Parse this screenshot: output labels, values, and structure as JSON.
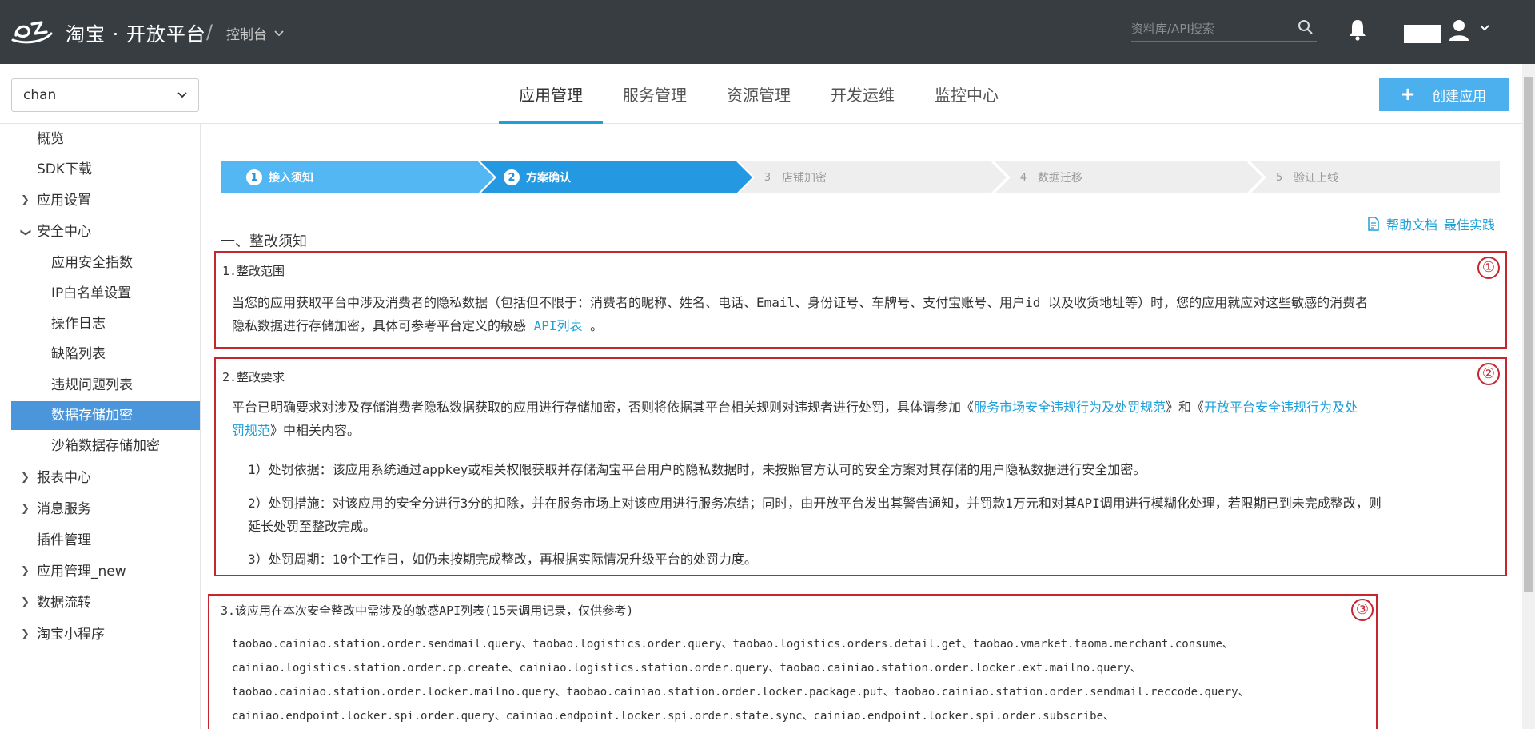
{
  "topbar": {
    "brand": "淘宝 · 开放平台",
    "separator": "/",
    "console_label": "控制台",
    "search_placeholder": "资料库/API搜索"
  },
  "subheader": {
    "app_select_value": "chan",
    "tabs": [
      "应用管理",
      "服务管理",
      "资源管理",
      "开发运维",
      "监控中心"
    ],
    "active_tab": "应用管理",
    "create_button": "创建应用"
  },
  "sidebar": {
    "items": [
      {
        "label": "概览",
        "level": 0,
        "expandable": false
      },
      {
        "label": "SDK下载",
        "level": 0,
        "expandable": false
      },
      {
        "label": "应用设置",
        "level": 0,
        "expandable": true,
        "expanded": false
      },
      {
        "label": "安全中心",
        "level": 0,
        "expandable": true,
        "expanded": true
      },
      {
        "label": "应用安全指数",
        "level": 1,
        "expandable": false
      },
      {
        "label": "IP白名单设置",
        "level": 1,
        "expandable": false
      },
      {
        "label": "操作日志",
        "level": 1,
        "expandable": false
      },
      {
        "label": "缺陷列表",
        "level": 1,
        "expandable": false
      },
      {
        "label": "违规问题列表",
        "level": 1,
        "expandable": false
      },
      {
        "label": "数据存储加密",
        "level": 1,
        "expandable": false,
        "active": true
      },
      {
        "label": "沙箱数据存储加密",
        "level": 1,
        "expandable": false
      },
      {
        "label": "报表中心",
        "level": 0,
        "expandable": true,
        "expanded": false
      },
      {
        "label": "消息服务",
        "level": 0,
        "expandable": true,
        "expanded": false
      },
      {
        "label": "插件管理",
        "level": 0,
        "expandable": false
      },
      {
        "label": "应用管理_new",
        "level": 0,
        "expandable": true,
        "expanded": false
      },
      {
        "label": "数据流转",
        "level": 0,
        "expandable": true,
        "expanded": false
      },
      {
        "label": "淘宝小程序",
        "level": 0,
        "expandable": true,
        "expanded": false
      }
    ]
  },
  "steps": [
    {
      "num": "1",
      "label": "接入须知",
      "state": "done"
    },
    {
      "num": "2",
      "label": "方案确认",
      "state": "current"
    },
    {
      "num": "3",
      "label": "店铺加密",
      "state": "todo"
    },
    {
      "num": "4",
      "label": "数据迁移",
      "state": "todo"
    },
    {
      "num": "5",
      "label": "验证上线",
      "state": "todo"
    }
  ],
  "help": {
    "doc": "帮助文档",
    "best": "最佳实践"
  },
  "section_title": "一、整改须知",
  "box1": {
    "marker": "①",
    "title": "1.整改范围",
    "line1": "当您的应用获取平台中涉及消费者的隐私数据（包括但不限于：消费者的昵称、姓名、电话、Email、身份证号、车牌号、支付宝账号、用户id 以及收货地址等）时，您的应用就应对这些敏感的消费者",
    "line2_pre": "隐私数据进行存储加密，具体可参考平台定义的敏感 ",
    "line2_link": "API列表",
    "line2_post": " 。"
  },
  "box2": {
    "marker": "②",
    "title": "2.整改要求",
    "p1_pre": "平台已明确要求对涉及存储消费者隐私数据获取的应用进行存储加密，否则将依据其平台相关规则对违规者进行处罚，具体请参加《",
    "p1_link1": "服务市场安全违规行为及处罚规范",
    "p1_mid": "》和《",
    "p1_link2a": "开放平台安全违规行为及处",
    "p1_link2b": "罚规范",
    "p1_post": "》中相关内容。",
    "p2": "1）处罚依据：该应用系统通过appkey或相关权限获取并存储淘宝平台用户的隐私数据时，未按照官方认可的安全方案对其存储的用户隐私数据进行安全加密。",
    "p3_line1": "2）处罚措施：对该应用的安全分进行3分的扣除，并在服务市场上对该应用进行服务冻结；同时，由开放平台发出其警告通知，并罚款1万元和对其API调用进行模糊化处理，若限期已到未完成整改，则",
    "p3_line2": "延长处罚至整改完成。",
    "p4": "3）处罚周期：10个工作日，如仍未按期完成整改，再根据实际情况升级平台的处罚力度。"
  },
  "box3": {
    "marker": "③",
    "title": "3.该应用在本次安全整改中需涉及的敏感API列表(15天调用记录，仅供参考)",
    "lines": [
      "taobao.cainiao.station.order.sendmail.query、taobao.logistics.order.query、taobao.logistics.orders.detail.get、taobao.vmarket.taoma.merchant.consume、",
      "cainiao.logistics.station.order.cp.create、cainiao.logistics.station.order.query、taobao.cainiao.station.order.locker.ext.mailno.query、",
      "taobao.cainiao.station.order.locker.mailno.query、taobao.cainiao.station.order.locker.package.put、taobao.cainiao.station.order.sendmail.reccode.query、",
      "cainiao.endpoint.locker.spi.order.query、cainiao.endpoint.locker.spi.order.state.sync、cainiao.endpoint.locker.spi.order.subscribe、"
    ]
  }
}
